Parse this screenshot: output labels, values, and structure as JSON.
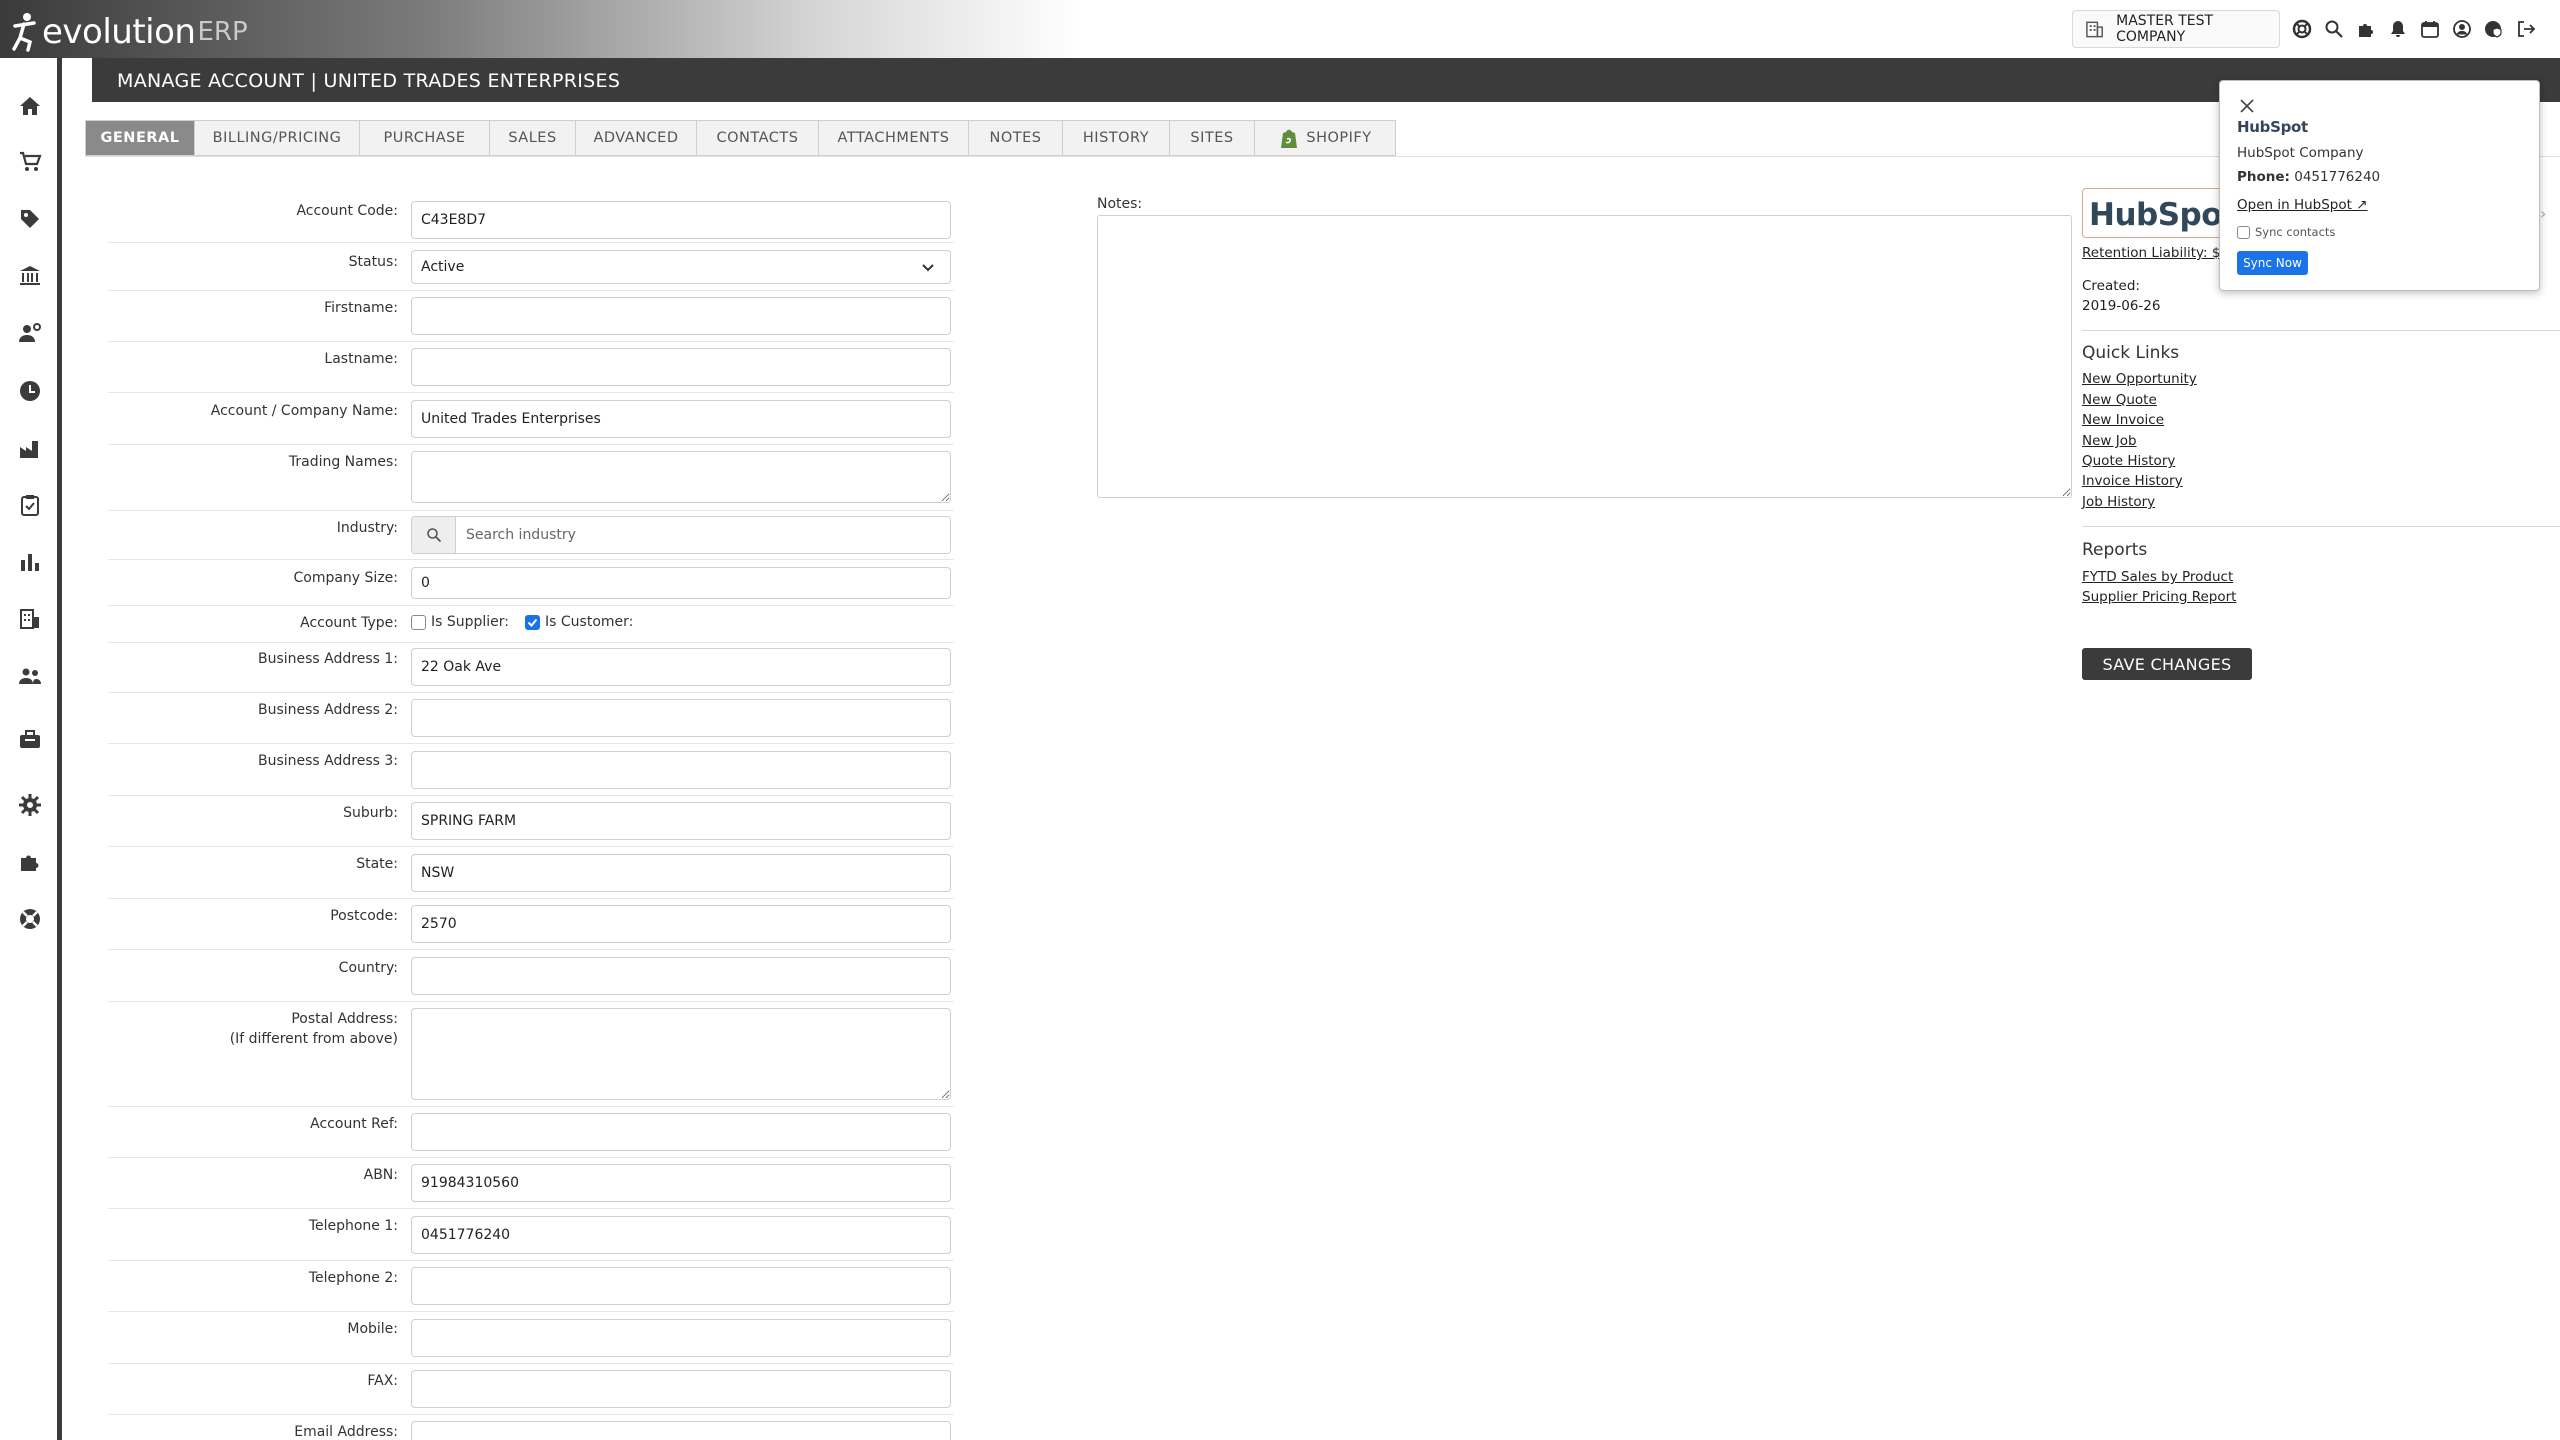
{
  "app": {
    "logo_word": "evolution",
    "logo_suffix": "ERP"
  },
  "topbar": {
    "company_name": "MASTER TEST COMPANY",
    "icons": [
      "support-icon",
      "search-icon",
      "puzzle-icon",
      "bell-icon",
      "calendar-icon",
      "user-icon",
      "shield-icon",
      "logout-icon"
    ]
  },
  "sidebar": {
    "icons": [
      "home-icon",
      "cart-icon",
      "tag-icon",
      "bank-icon",
      "user-gear-icon",
      "clock-icon",
      "factory-icon",
      "clipboard-check-icon",
      "bar-chart-icon",
      "building-icon",
      "people-icon",
      "toolbox-icon",
      "gear-icon",
      "puzzle-icon",
      "lifebuoy-icon"
    ]
  },
  "header": {
    "title": "MANAGE ACCOUNT | UNITED TRADES ENTERPRISES"
  },
  "tabs": [
    "GENERAL",
    "BILLING/PRICING",
    "PURCHASE",
    "SALES",
    "ADVANCED",
    "CONTACTS",
    "ATTACHMENTS",
    "NOTES",
    "HISTORY",
    "SITES",
    "SHOPIFY"
  ],
  "form": {
    "account_code": {
      "label": "Account Code:",
      "value": "C43E8D7"
    },
    "status": {
      "label": "Status:",
      "value": "Active"
    },
    "firstname": {
      "label": "Firstname:",
      "value": ""
    },
    "lastname": {
      "label": "Lastname:",
      "value": ""
    },
    "company_name": {
      "label": "Account / Company Name:",
      "value": "United Trades Enterprises"
    },
    "trading_names": {
      "label": "Trading Names:",
      "value": ""
    },
    "industry": {
      "label": "Industry:",
      "placeholder": "Search industry"
    },
    "company_size": {
      "label": "Company Size:",
      "value": "0"
    },
    "account_type": {
      "label": "Account Type:",
      "supplier_label": "Is Supplier:",
      "customer_label": "Is Customer:",
      "is_supplier": false,
      "is_customer": true
    },
    "address1": {
      "label": "Business Address 1:",
      "value": "22 Oak Ave"
    },
    "address2": {
      "label": "Business Address 2:",
      "value": ""
    },
    "address3": {
      "label": "Business Address 3:",
      "value": ""
    },
    "suburb": {
      "label": "Suburb:",
      "value": "SPRING FARM"
    },
    "state": {
      "label": "State:",
      "value": "NSW"
    },
    "postcode": {
      "label": "Postcode:",
      "value": "2570"
    },
    "country": {
      "label": "Country:",
      "value": ""
    },
    "postal_address": {
      "label": "Postal Address:",
      "sublabel": "(If different from above)",
      "value": ""
    },
    "account_ref": {
      "label": "Account Ref:",
      "value": ""
    },
    "abn": {
      "label": "ABN:",
      "value": "91984310560"
    },
    "telephone1": {
      "label": "Telephone 1:",
      "value": "0451776240"
    },
    "telephone2": {
      "label": "Telephone 2:",
      "value": ""
    },
    "mobile": {
      "label": "Mobile:",
      "value": ""
    },
    "fax": {
      "label": "FAX:",
      "value": ""
    },
    "email": {
      "label": "Email Address:",
      "value": ""
    }
  },
  "notes": {
    "label": "Notes:",
    "value": ""
  },
  "right_panel": {
    "hubspot_banner": "HubSpot",
    "retention": "Retention Liability: $0",
    "created_label": "Created:",
    "created_value": "2019-06-26",
    "quick_links_title": "Quick Links",
    "quick_links": [
      "New Opportunity",
      "New Quote",
      "New Invoice",
      "New Job",
      "Quote History",
      "Invoice History",
      "Job History"
    ],
    "reports_title": "Reports",
    "reports": [
      "FYTD Sales by Product",
      "Supplier Pricing Report"
    ],
    "save_label": "SAVE CHANGES"
  },
  "popup": {
    "logo": "HubSpot",
    "type": "HubSpot Company",
    "phone_label": "Phone:",
    "phone_value": "0451776240",
    "open_link": "Open in HubSpot ↗",
    "sync_contacts_label": "Sync contacts",
    "sync_button": "Sync Now"
  },
  "colors": {
    "dark": "#3b3b3b",
    "accent_blue": "#1a73e8",
    "hubspot_orange": "#ff7a59"
  }
}
